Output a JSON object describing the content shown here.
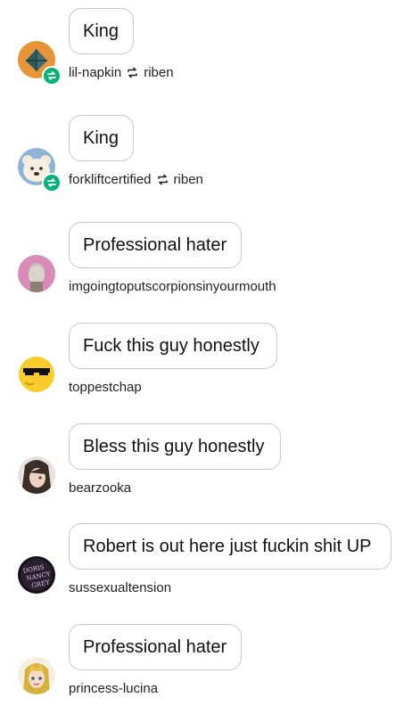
{
  "notes": [
    {
      "text": "King",
      "username": "lil-napkin",
      "reblogged_from": "riben",
      "is_reblog": true,
      "avatar_icon": "triangle-logo-avatar"
    },
    {
      "text": "King",
      "username": "forkliftcertified",
      "reblogged_from": "riben",
      "is_reblog": true,
      "avatar_icon": "teddy-bear-avatar"
    },
    {
      "text": "Professional hater",
      "username": "imgoingtoputscorpionsinyourmouth",
      "reblogged_from": "",
      "is_reblog": false,
      "avatar_icon": "portrait-avatar"
    },
    {
      "text": "Fuck this guy honestly",
      "username": "toppestchap",
      "reblogged_from": "",
      "is_reblog": false,
      "avatar_icon": "sunglasses-emoji-avatar"
    },
    {
      "text": "Bless this guy honestly",
      "username": "bearzooka",
      "reblogged_from": "",
      "is_reblog": false,
      "avatar_icon": "anime-character-avatar"
    },
    {
      "text": "Robert is out here just fuckin shit UP",
      "username": "sussexualtension",
      "reblogged_from": "",
      "is_reblog": false,
      "avatar_icon": "doris-nancy-grey-avatar",
      "avatar_text": "Doris Nancy Grey"
    },
    {
      "text": "Professional hater",
      "username": "princess-lucina",
      "reblogged_from": "",
      "is_reblog": false,
      "avatar_icon": "princess-avatar"
    }
  ],
  "colors": {
    "reblog_badge": "#00b478",
    "bubble_border": "#c9c9c9",
    "text": "#111111"
  }
}
